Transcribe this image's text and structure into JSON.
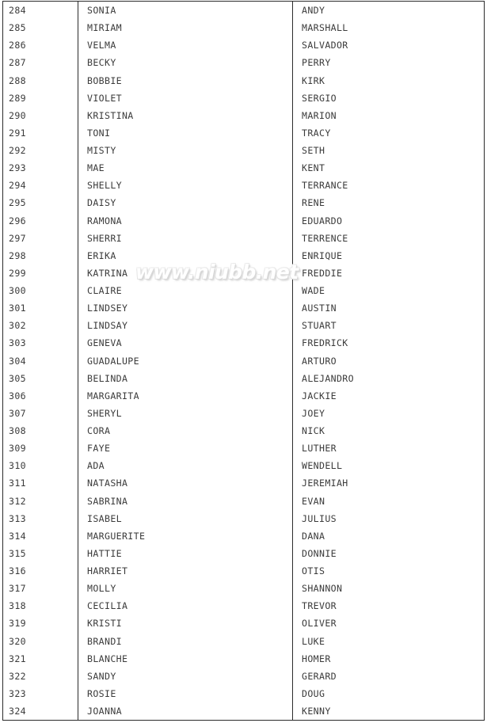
{
  "document": {
    "type": "name-list-table",
    "columns": [
      "index",
      "female_name",
      "male_name"
    ],
    "row_count": 41,
    "index_range": [
      284,
      324
    ]
  },
  "watermark": {
    "text": "www.niubb.net"
  },
  "colors": {
    "border": "#2b2b2b",
    "text": "#3b3b3b",
    "background": "#ffffff",
    "watermark_fill": "#ffffff",
    "watermark_shadow": "#d8d8d8"
  },
  "rows": [
    {
      "index": "284",
      "female": "SONIA",
      "male": "ANDY"
    },
    {
      "index": "285",
      "female": "MIRIAM",
      "male": "MARSHALL"
    },
    {
      "index": "286",
      "female": "VELMA",
      "male": "SALVADOR"
    },
    {
      "index": "287",
      "female": "BECKY",
      "male": "PERRY"
    },
    {
      "index": "288",
      "female": "BOBBIE",
      "male": "KIRK"
    },
    {
      "index": "289",
      "female": "VIOLET",
      "male": "SERGIO"
    },
    {
      "index": "290",
      "female": "KRISTINA",
      "male": "MARION"
    },
    {
      "index": "291",
      "female": "TONI",
      "male": "TRACY"
    },
    {
      "index": "292",
      "female": "MISTY",
      "male": "SETH"
    },
    {
      "index": "293",
      "female": "MAE",
      "male": "KENT"
    },
    {
      "index": "294",
      "female": "SHELLY",
      "male": "TERRANCE"
    },
    {
      "index": "295",
      "female": "DAISY",
      "male": "RENE"
    },
    {
      "index": "296",
      "female": "RAMONA",
      "male": "EDUARDO"
    },
    {
      "index": "297",
      "female": "SHERRI",
      "male": "TERRENCE"
    },
    {
      "index": "298",
      "female": "ERIKA",
      "male": "ENRIQUE"
    },
    {
      "index": "299",
      "female": "KATRINA",
      "male": "FREDDIE"
    },
    {
      "index": "300",
      "female": "CLAIRE",
      "male": "WADE"
    },
    {
      "index": "301",
      "female": "LINDSEY",
      "male": "AUSTIN"
    },
    {
      "index": "302",
      "female": "LINDSAY",
      "male": "STUART"
    },
    {
      "index": "303",
      "female": "GENEVA",
      "male": "FREDRICK"
    },
    {
      "index": "304",
      "female": "GUADALUPE",
      "male": "ARTURO"
    },
    {
      "index": "305",
      "female": "BELINDA",
      "male": "ALEJANDRO"
    },
    {
      "index": "306",
      "female": "MARGARITA",
      "male": "JACKIE"
    },
    {
      "index": "307",
      "female": "SHERYL",
      "male": "JOEY"
    },
    {
      "index": "308",
      "female": "CORA",
      "male": "NICK"
    },
    {
      "index": "309",
      "female": "FAYE",
      "male": "LUTHER"
    },
    {
      "index": "310",
      "female": "ADA",
      "male": "WENDELL"
    },
    {
      "index": "311",
      "female": "NATASHA",
      "male": "JEREMIAH"
    },
    {
      "index": "312",
      "female": "SABRINA",
      "male": "EVAN"
    },
    {
      "index": "313",
      "female": "ISABEL",
      "male": "JULIUS"
    },
    {
      "index": "314",
      "female": "MARGUERITE",
      "male": "DANA"
    },
    {
      "index": "315",
      "female": "HATTIE",
      "male": "DONNIE"
    },
    {
      "index": "316",
      "female": "HARRIET",
      "male": "OTIS"
    },
    {
      "index": "317",
      "female": "MOLLY",
      "male": "SHANNON"
    },
    {
      "index": "318",
      "female": "CECILIA",
      "male": "TREVOR"
    },
    {
      "index": "319",
      "female": "KRISTI",
      "male": "OLIVER"
    },
    {
      "index": "320",
      "female": "BRANDI",
      "male": "LUKE"
    },
    {
      "index": "321",
      "female": "BLANCHE",
      "male": "HOMER"
    },
    {
      "index": "322",
      "female": "SANDY",
      "male": "GERARD"
    },
    {
      "index": "323",
      "female": "ROSIE",
      "male": "DOUG"
    },
    {
      "index": "324",
      "female": "JOANNA",
      "male": "KENNY"
    }
  ]
}
